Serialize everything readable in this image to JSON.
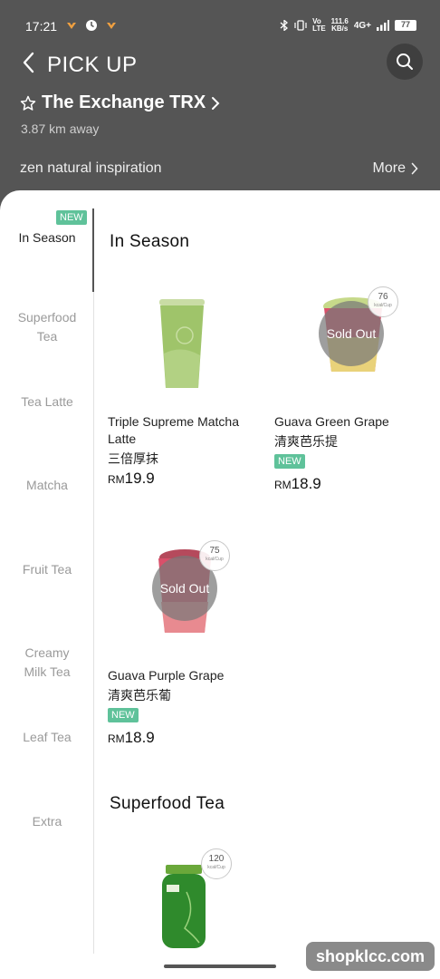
{
  "status_bar": {
    "time": "17:21",
    "speed_top": "111.6",
    "speed_bottom": "KB/s",
    "network": "4G+",
    "battery": "77"
  },
  "header": {
    "title": "PICK UP",
    "store_name": "The Exchange TRX",
    "distance": "3.87 km away",
    "tagline": "zen natural inspiration",
    "more_label": "More",
    "background_color": "#555555"
  },
  "sidebar": {
    "items": [
      {
        "label": "In Season",
        "badge": "NEW",
        "active": true
      },
      {
        "label": "Superfood Tea"
      },
      {
        "label": "Tea Latte"
      },
      {
        "label": "Matcha"
      },
      {
        "label": "Fruit Tea"
      },
      {
        "label": "Creamy Milk Tea"
      },
      {
        "label": "Leaf Tea"
      },
      {
        "label": "Extra"
      }
    ]
  },
  "sections": [
    {
      "title": "In Season",
      "products": [
        {
          "name": "Triple Supreme Matcha Latte",
          "name_cn": "三倍厚抹",
          "currency": "RM",
          "price": "19.9",
          "sold_out": false,
          "badge": "",
          "kcal": ""
        },
        {
          "name": "Guava Green Grape",
          "name_cn": "清爽芭乐提",
          "currency": "RM",
          "price": "18.9",
          "sold_out": true,
          "sold_out_label": "Sold Out",
          "badge": "NEW",
          "kcal": "76",
          "kcal_unit": "kcal/Cup"
        },
        {
          "name": "Guava Purple Grape",
          "name_cn": "清爽芭乐葡",
          "currency": "RM",
          "price": "18.9",
          "sold_out": true,
          "sold_out_label": "Sold Out",
          "badge": "NEW",
          "kcal": "75",
          "kcal_unit": "kcal/Cup"
        }
      ]
    },
    {
      "title": "Superfood Tea",
      "products": [
        {
          "kcal": "120",
          "kcal_unit": "kcal/Cup"
        }
      ]
    }
  ],
  "watermark": "shopklcc.com",
  "colors": {
    "accent_new": "#5fc29a",
    "header_bg": "#555555",
    "matcha_green": "#9fc46a",
    "guava_red": "#d9506a"
  }
}
